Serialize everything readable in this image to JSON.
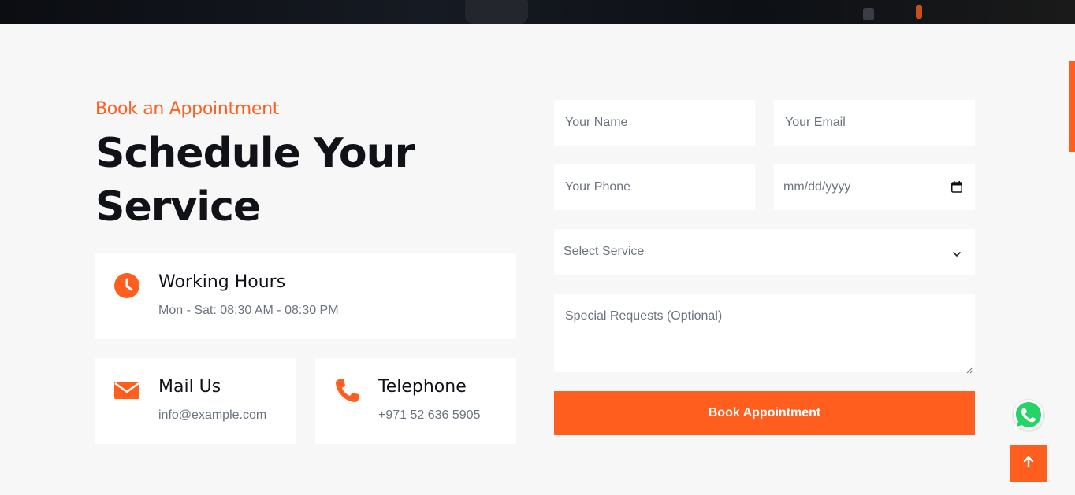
{
  "header": {
    "eyebrow": "Book an Appointment",
    "title": "Schedule Your Service"
  },
  "info_cards": {
    "hours": {
      "title": "Working Hours",
      "text": "Mon - Sat: 08:30 AM - 08:30 PM",
      "icon": "clock-icon"
    },
    "mail": {
      "title": "Mail Us",
      "text": "info@example.com",
      "icon": "envelope-icon"
    },
    "phone": {
      "title": "Telephone",
      "text": "+971 52 636 5905",
      "icon": "phone-icon"
    }
  },
  "form": {
    "name_placeholder": "Your Name",
    "email_placeholder": "Your Email",
    "phone_placeholder": "Your Phone",
    "date_placeholder": "mm/dd/yyyy",
    "service_selected": "Select Service",
    "requests_placeholder": "Special Requests (Optional)",
    "submit_label": "Book Appointment"
  },
  "floating": {
    "whatsapp_icon": "whatsapp-icon",
    "back_to_top_icon": "arrow-up-icon"
  },
  "colors": {
    "accent": "#ff5e1f",
    "heading": "#111218",
    "muted": "#6c7380",
    "background": "#f7f7f7",
    "whatsapp": "#25d366"
  }
}
